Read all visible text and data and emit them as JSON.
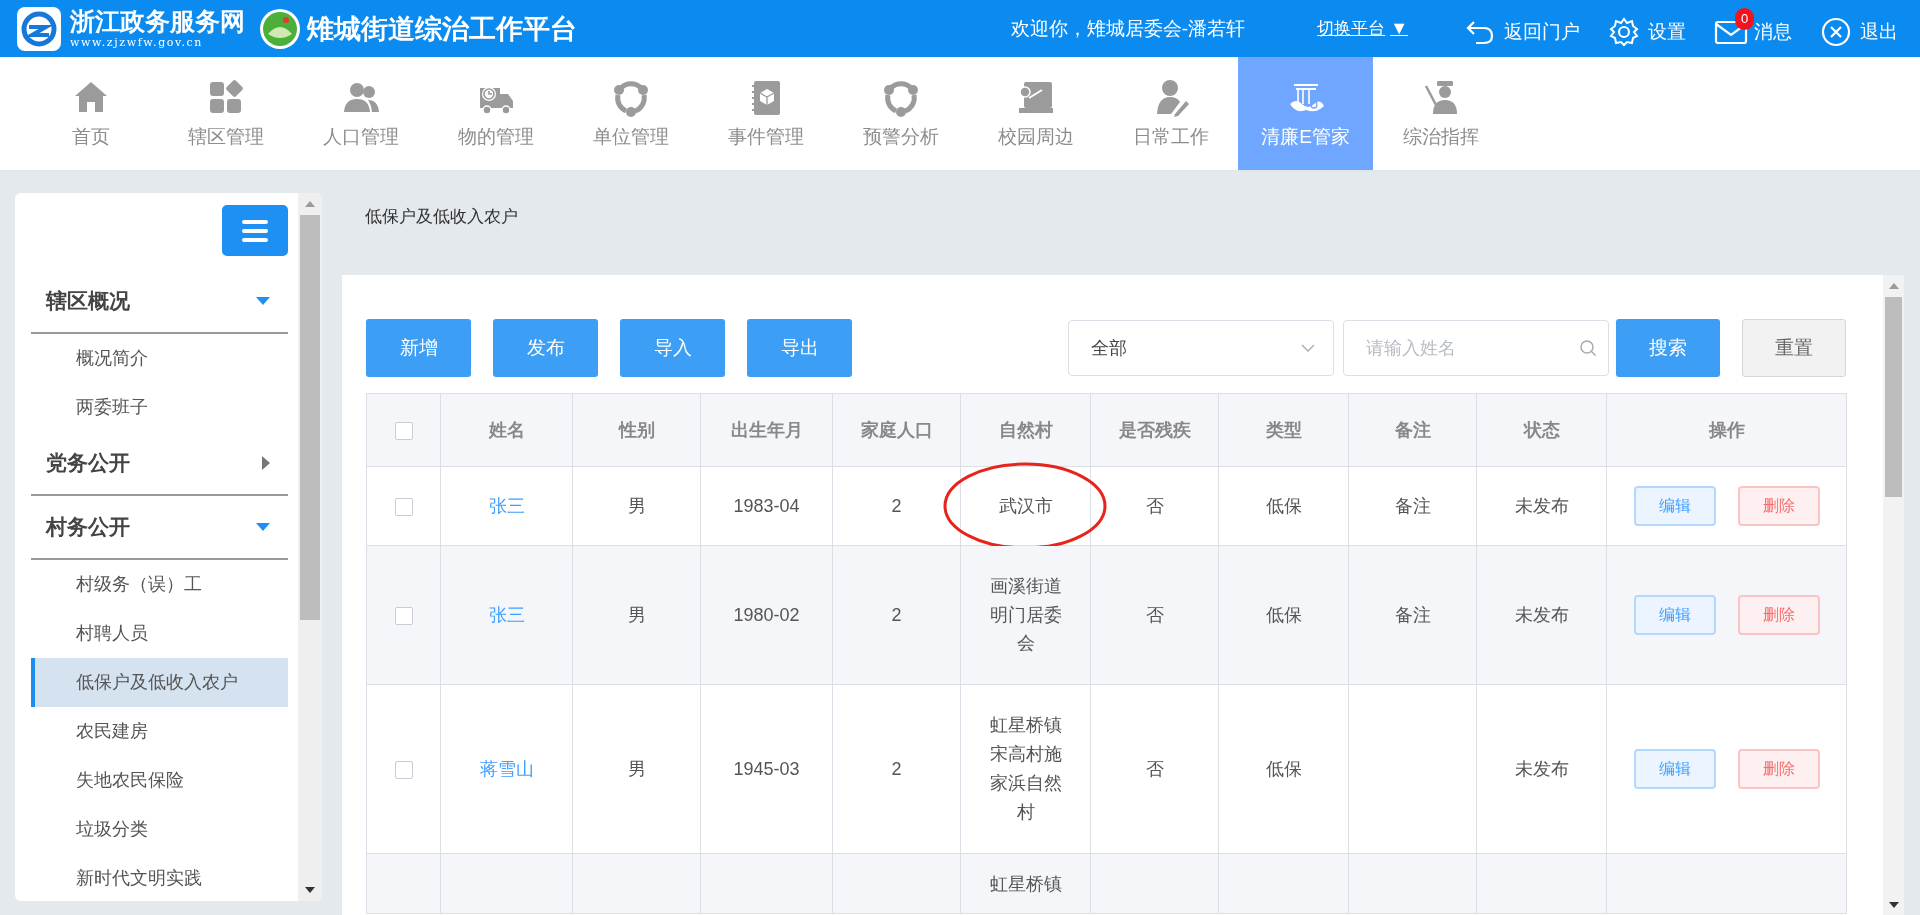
{
  "header": {
    "portal_name": "浙江政务服务网",
    "portal_url": "www.zjzwfw.gov.cn",
    "app_title": "雉城街道综治工作平台",
    "welcome": "欢迎你，雉城居委会-潘若轩",
    "switch_platform": "切换平台",
    "switch_caret": "▼",
    "actions": [
      {
        "kind": "back",
        "label": "返回门户"
      },
      {
        "kind": "settings",
        "label": "设置"
      },
      {
        "kind": "mail",
        "label": "消息",
        "badge": "0"
      },
      {
        "kind": "logout",
        "label": "退出"
      }
    ]
  },
  "nav": [
    {
      "kind": "home",
      "label": "首页",
      "selected": false
    },
    {
      "kind": "grid",
      "label": "辖区管理",
      "selected": false
    },
    {
      "kind": "people",
      "label": "人口管理",
      "selected": false
    },
    {
      "kind": "truck",
      "label": "物的管理",
      "selected": false
    },
    {
      "kind": "network",
      "label": "单位管理",
      "selected": false
    },
    {
      "kind": "book",
      "label": "事件管理",
      "selected": false
    },
    {
      "kind": "network",
      "label": "预警分析",
      "selected": false
    },
    {
      "kind": "board",
      "label": "校园周边",
      "selected": false
    },
    {
      "kind": "writer",
      "label": "日常工作",
      "selected": false
    },
    {
      "kind": "pavilion",
      "label": "清廉E管家",
      "selected": true
    },
    {
      "kind": "officer",
      "label": "综治指挥",
      "selected": false
    }
  ],
  "sidebar": {
    "groups": [
      {
        "label": "辖区概况",
        "expanded": true,
        "children": [
          {
            "label": "概况简介",
            "selected": false
          },
          {
            "label": "两委班子",
            "selected": false
          }
        ]
      },
      {
        "label": "党务公开",
        "expanded": false
      },
      {
        "label": "村务公开",
        "expanded": true,
        "children": [
          {
            "label": "村级务（误）工",
            "selected": false
          },
          {
            "label": "村聘人员",
            "selected": false
          },
          {
            "label": "低保户及低收入农户",
            "selected": true
          },
          {
            "label": "农民建房",
            "selected": false
          },
          {
            "label": "失地农民保险",
            "selected": false
          },
          {
            "label": "垃圾分类",
            "selected": false
          },
          {
            "label": "新时代文明实践",
            "selected": false
          }
        ]
      }
    ]
  },
  "page_title": "低保户及低收入农户",
  "toolbar": {
    "buttons": [
      "新增",
      "发布",
      "导入",
      "导出"
    ],
    "filter": {
      "value": "全部"
    },
    "search": {
      "placeholder": "请输入姓名"
    },
    "search_button": "搜索",
    "reset_button": "重置"
  },
  "table": {
    "all_checked": false,
    "columns": [
      "姓名",
      "性别",
      "出生年月",
      "家庭人口",
      "自然村",
      "是否残疾",
      "类型",
      "备注",
      "状态",
      "操作"
    ],
    "rows": [
      {
        "checked": false,
        "cells": [
          "张三",
          "男",
          "1983-04",
          "2",
          "武汉市",
          "否",
          "低保",
          "备注",
          "未发布"
        ],
        "circled": true,
        "actions": [
          "编辑",
          "删除"
        ]
      },
      {
        "checked": false,
        "cells": [
          "张三",
          "男",
          "1980-02",
          "2",
          "画溪街道明门居委会",
          "否",
          "低保",
          "备注",
          "未发布"
        ],
        "circled": false,
        "actions": [
          "编辑",
          "删除"
        ]
      },
      {
        "checked": false,
        "cells": [
          "蒋雪山",
          "男",
          "1945-03",
          "2",
          "虹星桥镇宋高村施家浜自然村",
          "否",
          "低保",
          "",
          "未发布"
        ],
        "circled": false,
        "actions": [
          "编辑",
          "删除"
        ]
      },
      {
        "cells": [
          "",
          "",
          "",
          "",
          "虹星桥镇",
          "",
          "",
          "",
          ""
        ],
        "circled": false
      }
    ]
  }
}
